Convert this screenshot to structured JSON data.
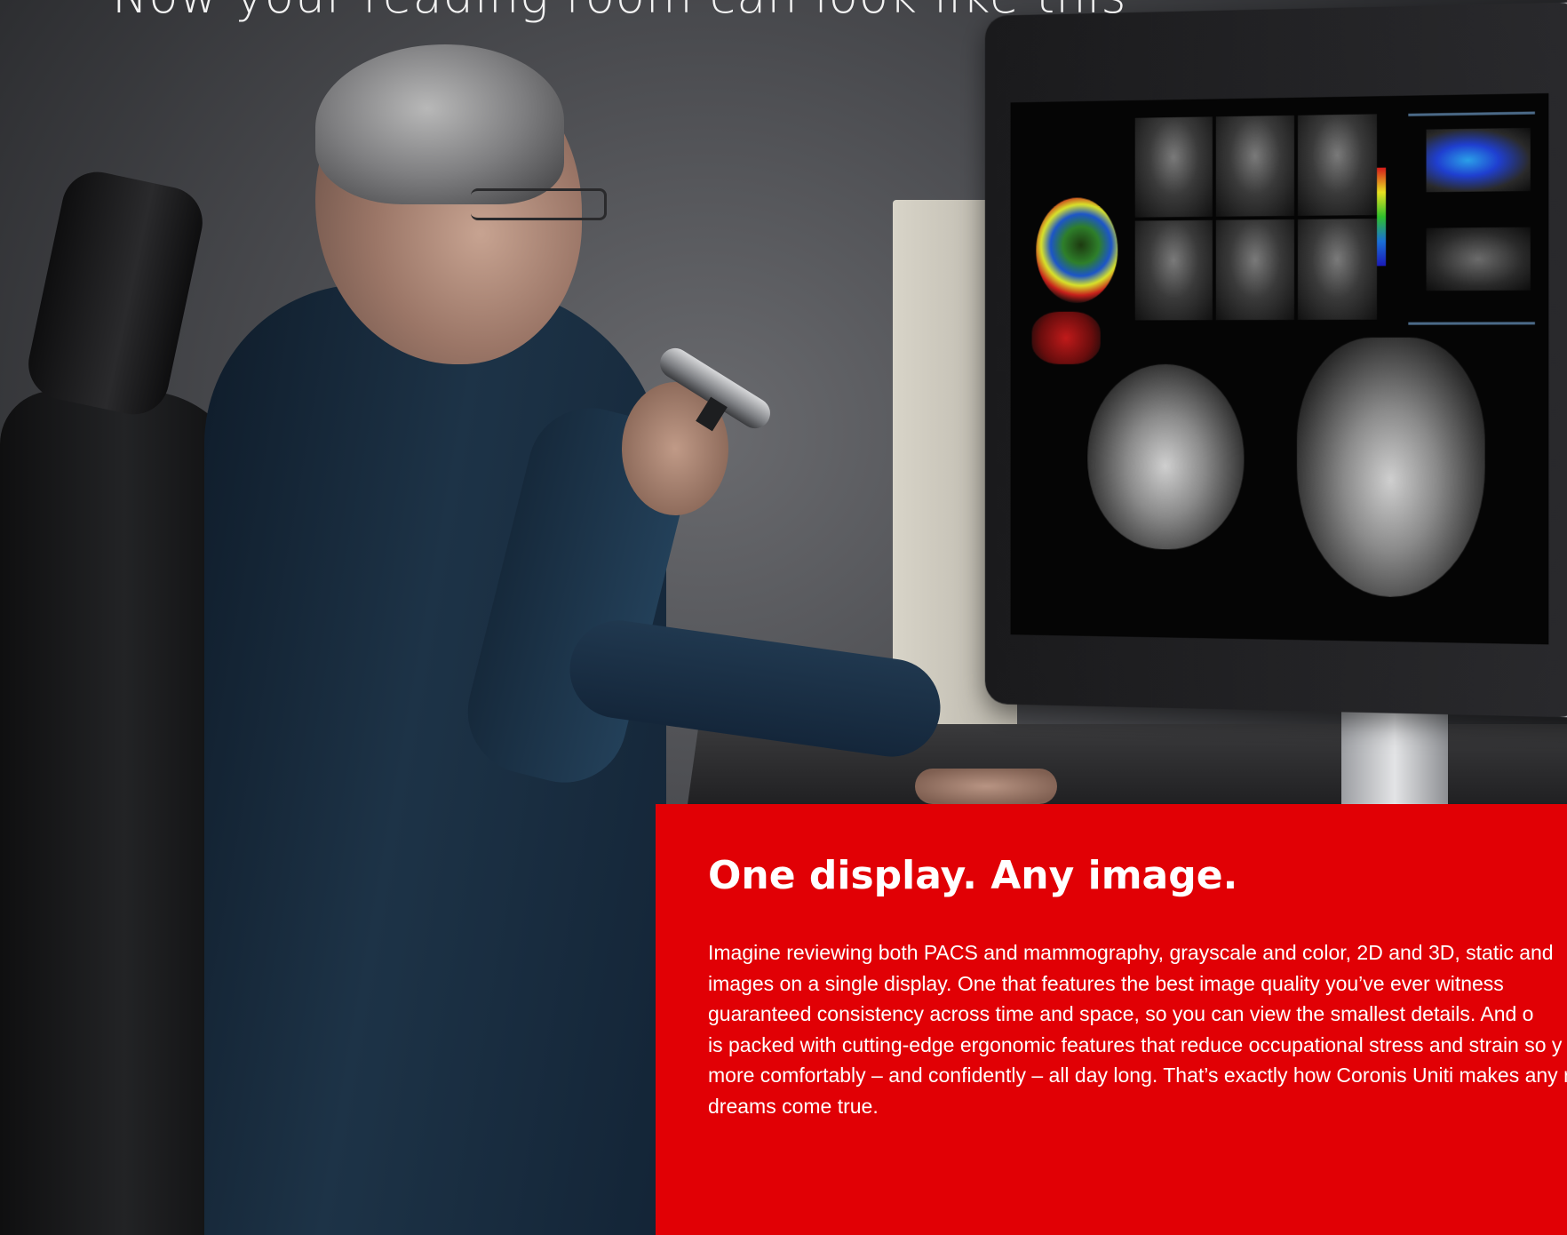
{
  "headline": "Now your reading room can look like this",
  "callout": {
    "title": "One display. Any image.",
    "body_lines": [
      "Imagine reviewing both PACS and mammography, grayscale and color, 2D and 3D, static and",
      "images on a single display. One that features the best image quality you’ve ever witness",
      "guaranteed consistency across time and space, so you can view the smallest details. And o",
      "is packed with cutting-edge ergonomic features that reduce occupational stress and strain so y",
      "more comfortably – and confidently – all day long.  That’s exactly how Coronis Uniti makes any rad",
      "dreams come true."
    ]
  },
  "colors": {
    "panel": "#e10005",
    "text": "#ffffff",
    "background": "#3a3b3e"
  }
}
